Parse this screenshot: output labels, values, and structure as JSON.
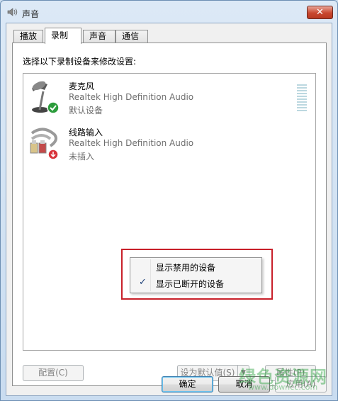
{
  "window": {
    "title": "声音",
    "close_label": "✕"
  },
  "tabs": [
    {
      "label": "播放",
      "active": false
    },
    {
      "label": "录制",
      "active": true
    },
    {
      "label": "声音",
      "active": false
    },
    {
      "label": "通信",
      "active": false
    }
  ],
  "panel": {
    "prompt": "选择以下录制设备来修改设置:"
  },
  "devices": [
    {
      "name": "麦克风",
      "driver": "Realtek High Definition Audio",
      "status": "默认设备",
      "icon": "microphone-icon",
      "badge": "check-badge-icon"
    },
    {
      "name": "线路输入",
      "driver": "Realtek High Definition Audio",
      "status": "未插入",
      "icon": "line-in-cable-icon",
      "badge": "unplugged-badge-icon"
    }
  ],
  "context_menu": {
    "items": [
      {
        "label": "显示禁用的设备",
        "checked": false
      },
      {
        "label": "显示已断开的设备",
        "checked": true
      }
    ],
    "check_glyph": "✓"
  },
  "buttons": {
    "configure": "配置(C)",
    "set_default": "设为默认值(S)",
    "set_default_arrow": "▼",
    "properties": "属性(P)",
    "ok": "确定",
    "cancel": "取消",
    "apply": "应用(A)"
  },
  "watermark": {
    "text": "绿色资源网",
    "sub": "www.downcc.com"
  },
  "colors": {
    "highlight_border": "#c8202a",
    "default_check": "#2c9c3c"
  }
}
